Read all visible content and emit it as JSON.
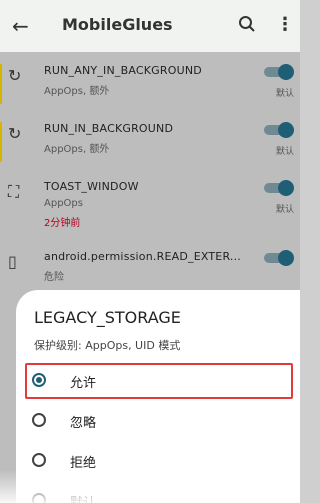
{
  "app_bar": {
    "title": "MobileGlues",
    "back_icon": "arrow-left-icon",
    "search_icon": "search-icon",
    "more_icon": "more-vertical-icon"
  },
  "list": [
    {
      "name": "RUN_ANY_IN_BACKGROUND",
      "sub": "AppOps, 额外",
      "status": "默认",
      "icon": "sync-icon"
    },
    {
      "name": "RUN_IN_BACKGROUND",
      "sub": "AppOps, 额外",
      "status": "默认",
      "icon": "sync-icon"
    },
    {
      "name": "TOAST_WINDOW",
      "sub": "AppOps",
      "time": "2分钟前",
      "status": "默认",
      "icon": "frame-icon"
    },
    {
      "name": "android.permission.READ_EXTER...",
      "sub": "危险",
      "status": "",
      "icon": "sd-card-icon"
    }
  ],
  "dialog": {
    "title": "LEGACY_STORAGE",
    "level": "保护级别:  AppOps, UID 模式",
    "options": [
      {
        "label": "允许",
        "checked": true
      },
      {
        "label": "忽略",
        "checked": false
      },
      {
        "label": "拒绝",
        "checked": false
      },
      {
        "label": "默认",
        "checked": false
      }
    ]
  },
  "colors": {
    "accent": "#1f5f75",
    "highlight": "#e23b3b",
    "warning": "#b00020"
  }
}
